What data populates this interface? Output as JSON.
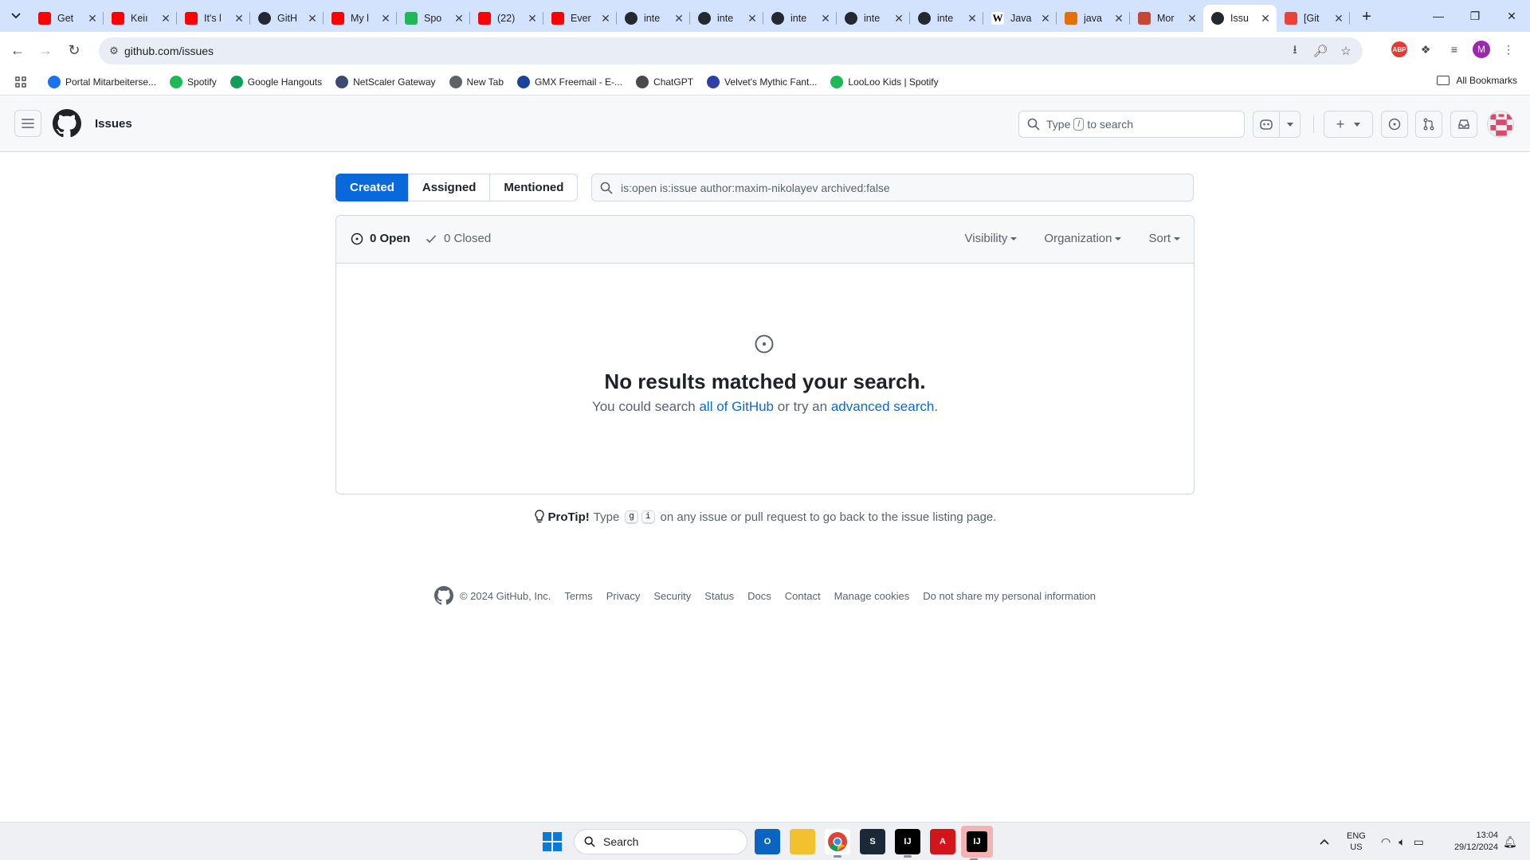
{
  "browser": {
    "tabs": [
      {
        "title": "Get",
        "icon": "youtube-icon",
        "color": "#ff0000"
      },
      {
        "title": "Keiı",
        "icon": "youtube-icon",
        "color": "#ff0000"
      },
      {
        "title": "It's l",
        "icon": "youtube-icon",
        "color": "#ff0000"
      },
      {
        "title": "GitH",
        "icon": "github-icon",
        "color": "#24292f"
      },
      {
        "title": "My l",
        "icon": "youtube-icon",
        "color": "#ff0000"
      },
      {
        "title": "Spo",
        "icon": "spotify-icon",
        "color": "#1db954"
      },
      {
        "title": "(22)",
        "icon": "youtube-icon",
        "color": "#ff0000"
      },
      {
        "title": "Ever",
        "icon": "youtube-icon",
        "color": "#ff0000"
      },
      {
        "title": "inte",
        "icon": "github-icon",
        "color": "#24292f"
      },
      {
        "title": "inte",
        "icon": "github-icon",
        "color": "#24292f"
      },
      {
        "title": "inte",
        "icon": "github-icon",
        "color": "#24292f"
      },
      {
        "title": "inte",
        "icon": "github-icon",
        "color": "#24292f"
      },
      {
        "title": "inte",
        "icon": "github-icon",
        "color": "#24292f"
      },
      {
        "title": "Java",
        "icon": "wikipedia-icon",
        "color": "#ffffff"
      },
      {
        "title": "java",
        "icon": "java-icon",
        "color": "#e76f00"
      },
      {
        "title": "Mor",
        "icon": "oracle-icon",
        "color": "#c74634"
      },
      {
        "title": "Issu",
        "icon": "github-icon",
        "color": "#24292f",
        "active": true
      },
      {
        "title": "[Git",
        "icon": "gmail-icon",
        "color": "#ea4335"
      }
    ],
    "url": "github.com/issues",
    "bookmarks": [
      {
        "label": "Portal Mitarbeiterse...",
        "color": "#1a73e8"
      },
      {
        "label": "Spotify",
        "color": "#1db954"
      },
      {
        "label": "Google Hangouts",
        "color": "#0f9d58"
      },
      {
        "label": "NetScaler Gateway",
        "color": "#3b4a73"
      },
      {
        "label": "New Tab",
        "color": "#5f6368"
      },
      {
        "label": "GMX Freemail - E-...",
        "color": "#1c449b"
      },
      {
        "label": "ChatGPT",
        "color": "#4a4a4a"
      },
      {
        "label": "Velvet's Mythic Fant...",
        "color": "#2f3ea8"
      },
      {
        "label": "LooLoo Kids | Spotify",
        "color": "#1db954"
      }
    ],
    "all_bookmarks": "All Bookmarks",
    "profile_initial": "M"
  },
  "github": {
    "context": "Issues",
    "search_prefix": "Type",
    "search_key": "/",
    "search_suffix": "to search",
    "filters": [
      "Created",
      "Assigned",
      "Mentioned"
    ],
    "selected_filter": "Created",
    "query": "is:open is:issue author:maxim-nikolayev archived:false",
    "open_count": "0 Open",
    "closed_count": "0 Closed",
    "menus": [
      "Visibility",
      "Organization",
      "Sort"
    ],
    "blank_title": "No results matched your search.",
    "blank_text_1": "You could search ",
    "blank_link_1": "all of GitHub",
    "blank_text_2": " or try an ",
    "blank_link_2": "advanced search",
    "blank_text_3": ".",
    "protip_label": "ProTip!",
    "protip_type": "Type",
    "protip_key_1": "g",
    "protip_key_2": "i",
    "protip_text": "on any issue or pull request to go back to the issue listing page.",
    "footer_copyright": "© 2024 GitHub, Inc.",
    "footer_links": [
      "Terms",
      "Privacy",
      "Security",
      "Status",
      "Docs",
      "Contact",
      "Manage cookies",
      "Do not share my personal information"
    ],
    "accent": "#0969da"
  },
  "taskbar": {
    "search_label": "Search",
    "lang_top": "ENG",
    "lang_bottom": "US",
    "time": "13:04",
    "date": "29/12/2024"
  }
}
